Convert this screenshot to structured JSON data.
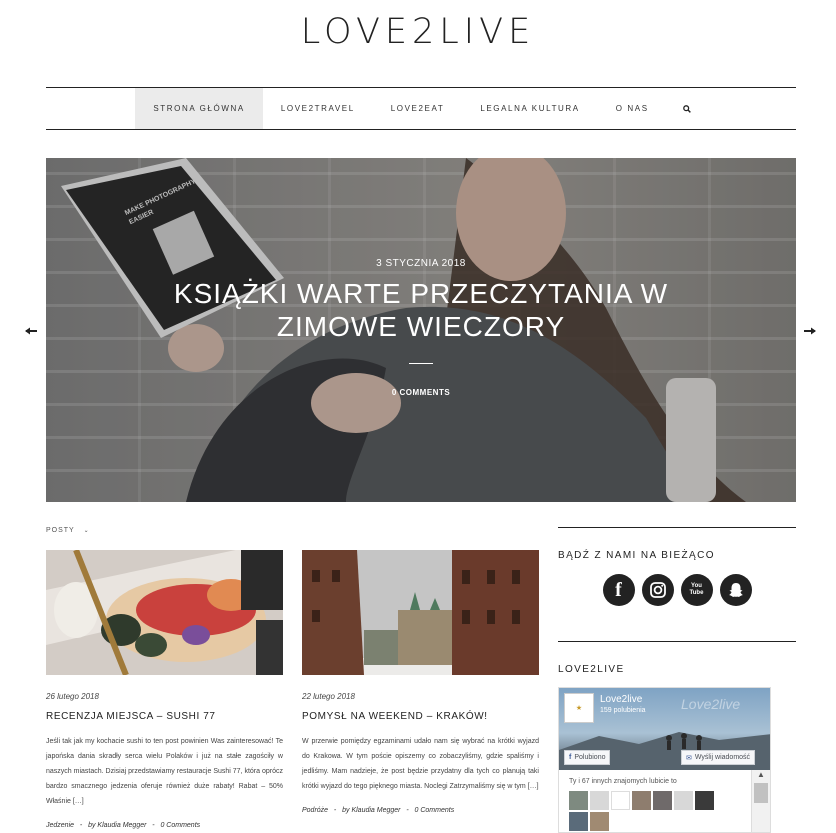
{
  "site": {
    "logo": "LOVE2LIVE"
  },
  "nav": {
    "items": [
      {
        "label": "STRONA GŁÓWNA",
        "active": true
      },
      {
        "label": "LOVE2TRAVEL",
        "active": false
      },
      {
        "label": "LOVE2EAT",
        "active": false
      },
      {
        "label": "LEGALNA KULTURA",
        "active": false
      },
      {
        "label": "O NAS",
        "active": false
      }
    ],
    "search_icon": "search-icon"
  },
  "slider": {
    "prev_icon": "arrow-left-icon",
    "next_icon": "arrow-right-icon",
    "slide": {
      "date": "3 STYCZNIA 2018",
      "title": "KSIĄŻKI WARTE PRZECZYTANIA W ZIMOWE WIECZORY",
      "comments": "0 COMMENTS",
      "book_text": "MAKE PHOTOGRAPHY EASIER"
    }
  },
  "posts": {
    "label": "POSTY",
    "items": [
      {
        "date": "26 lutego 2018",
        "title": "RECENZJA MIEJSCA – SUSHI 77",
        "excerpt": "Jeśli tak jak my kochacie sushi to ten post powinien Was zainteresować! Te japońska dania skradły serca wielu Polaków i już na stałe zagościły w naszych miastach. Dzisiaj przedstawiamy restauracje Sushi 77, która oprócz bardzo smacznego jedzenia oferuje również duże rabaty! Rabat – 50% Właśnie […]",
        "category": "Jedzenie",
        "author": "by Klaudia Megger",
        "comments": "0 Comments"
      },
      {
        "date": "22 lutego 2018",
        "title": "POMYSŁ NA WEEKEND – KRAKÓW!",
        "excerpt": "W przerwie pomiędzy egzaminami udało nam się wybrać na krótki wyjazd do Krakowa. W tym poście opiszemy co zobaczyliśmy, gdzie spaliśmy i jedliśmy. Mam nadzieje, że post będzie przydatny dla tych co planują taki krótki wyjazd do tego pięknego miasta. Noclegi Zatrzymaliśmy się w tym […]",
        "category": "Podróże",
        "author": "by Klaudia Megger",
        "comments": "0 Comments"
      }
    ]
  },
  "sidebar": {
    "social_heading": "BĄDŹ Z NAMI NA BIEŻĄCO",
    "social": [
      {
        "icon": "facebook-icon",
        "glyph": "f"
      },
      {
        "icon": "instagram-icon",
        "glyph": ""
      },
      {
        "icon": "youtube-icon",
        "glyph": "You Tube"
      },
      {
        "icon": "snapchat-icon",
        "glyph": ""
      }
    ],
    "fb_heading": "LOVE2LIVE",
    "fb_widget": {
      "page_name": "Love2live",
      "likes": "159 polubienia",
      "watermark": "Love2live",
      "like_button": "Polubiono",
      "message_button": "Wyślij wiadomość",
      "friends_text": "Ty i 67 innych znajomych lubicie to"
    }
  }
}
